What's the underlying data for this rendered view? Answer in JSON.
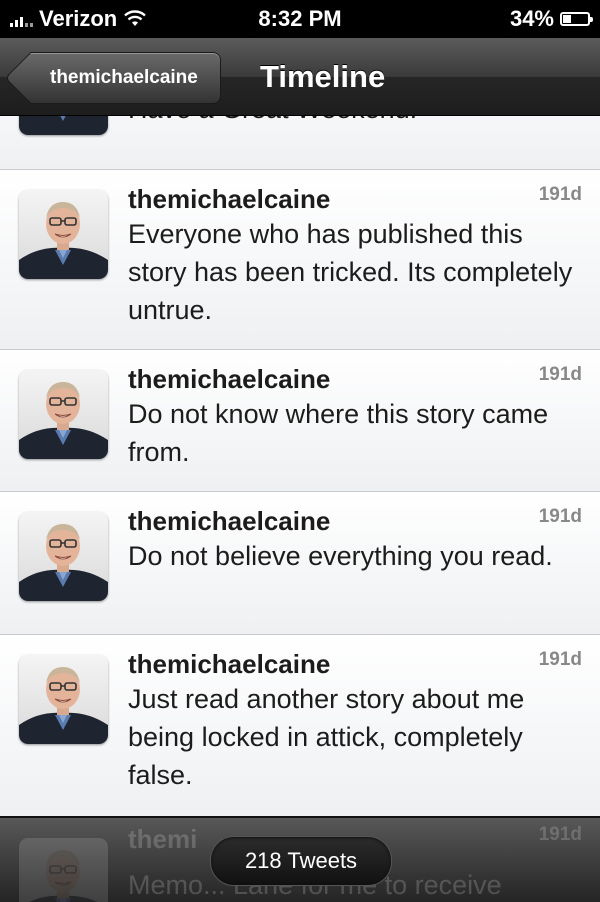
{
  "status_bar": {
    "carrier": "Verizon",
    "time": "8:32 PM",
    "battery_percent": "34%",
    "battery_level": 0.34
  },
  "nav": {
    "back_label": "themichaelcaine",
    "title": "Timeline"
  },
  "partial_top_text": "Have a Great Weekend.",
  "tweets": [
    {
      "username": "themichaelcaine",
      "time": "191d",
      "text": "Everyone who has published this story has been tricked. Its completely untrue."
    },
    {
      "username": "themichaelcaine",
      "time": "191d",
      "text": "Do not know where this story came from."
    },
    {
      "username": "themichaelcaine",
      "time": "191d",
      "text": "Do not believe everything you read."
    },
    {
      "username": "themichaelcaine",
      "time": "191d",
      "text": "Just read another story about me being locked in attick, completely false."
    }
  ],
  "ghost_tweet": {
    "username": "themi",
    "time": "191d",
    "text": "Memo... Lane for me to receive"
  },
  "bottom": {
    "tweet_count": "218 Tweets"
  },
  "icons": {
    "signal": "signal-bars-icon",
    "wifi": "wifi-icon",
    "battery": "battery-icon",
    "back": "back-arrow-button",
    "avatar": "avatar-photo"
  }
}
